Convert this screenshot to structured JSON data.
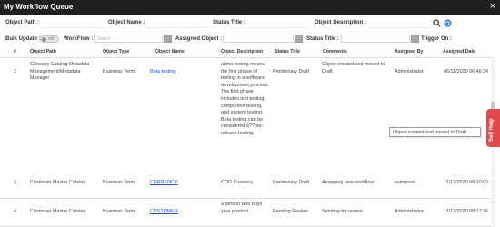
{
  "window": {
    "title": "My Workflow Queue",
    "close_glyph": "×"
  },
  "filters": {
    "object_path_label": "Object Path :",
    "object_name_label": "Object Name :",
    "status_title_label": "Status Title :",
    "object_description_label": "Object Description :",
    "bulk_update_label": "Bulk Update :",
    "bulk_toggle_text": "Off",
    "workflow_label": "WorkFlow :",
    "workflow_placeholder": "Select",
    "assigned_object_label": "Assigned Object :",
    "status_title2_label": "Status Title :",
    "trigger_on_label": "Trigger On :"
  },
  "icons": {
    "search": "search-icon",
    "refresh": "refresh-icon"
  },
  "colors": {
    "titlebar": "#1f1f1f",
    "link": "#1a4fd6",
    "self_help": "#e04a4a"
  },
  "table": {
    "headers": [
      "#",
      "Object Path",
      "Object Type",
      "Object Name",
      "Object Description",
      "Status Title",
      "Comments",
      "Assigned By",
      "Assigned Date"
    ],
    "rows": [
      {
        "num": "2",
        "path": "Glossary Catalog Metadata Management/Metadata Manager",
        "type": "Business Term",
        "name": "Beta testing",
        "description": "alpha testing means the first phase of testing in a software development process. The first phase includes unit testing, component testing, and system testing. Beta testing can be considered â??pre-release testing.",
        "status": "Preliminary Draft",
        "comments": "Object created and moved to Draft",
        "assigned_by": "Administrator",
        "assigned_date": "06/11/2020 06:46:34"
      },
      {
        "num": "3",
        "path": "Customer Master Catalog",
        "type": "Business Term",
        "name": "CURRENCY",
        "description": "COD Currency",
        "status": "Preliminary Draft",
        "comments": "Assigning new workflow.",
        "assigned_by": "esimpson",
        "assigned_date": "11/17/2020 08:10:02"
      },
      {
        "num": "4",
        "path": "Customer Master Catalog",
        "type": "Business Term",
        "name": "CUSTOMER",
        "description": "a person who buys your product",
        "status": "Pending Review",
        "comments": "Sending for review.",
        "assigned_by": "Administrator",
        "assigned_date": "11/17/2020 08:17:26"
      }
    ]
  },
  "tooltip": {
    "text": "Object created and moved to Draft"
  },
  "self_help": {
    "label": "Self Help"
  }
}
